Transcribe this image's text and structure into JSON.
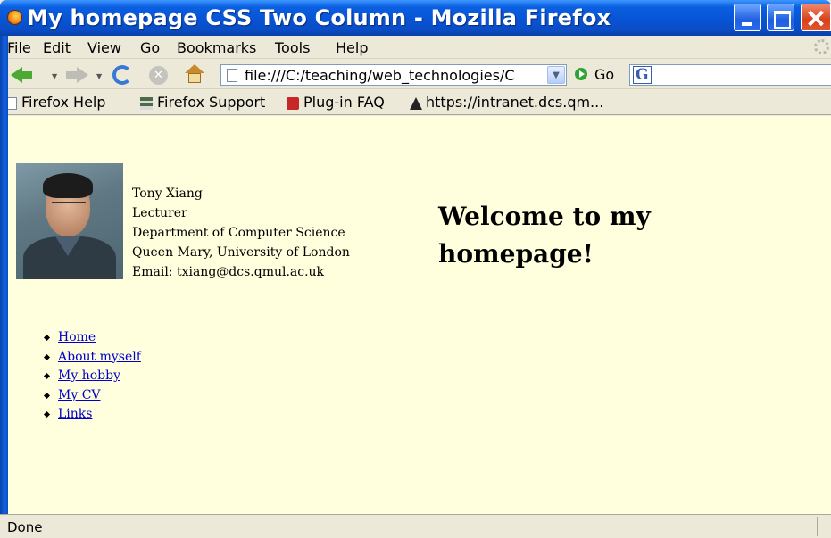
{
  "window": {
    "title": "My homepage CSS Two Column - Mozilla Firefox"
  },
  "menu": {
    "items": [
      "File",
      "Edit",
      "View",
      "Go",
      "Bookmarks",
      "Tools",
      "Help"
    ]
  },
  "navbar": {
    "url": "file:///C:/teaching/web_technologies/C",
    "go_label": "Go"
  },
  "bookmarks": {
    "items": [
      "Firefox Help",
      "Firefox Support",
      "Plug-in FAQ",
      "https://intranet.dcs.qm..."
    ]
  },
  "profile": {
    "name": "Tony Xiang",
    "role": "Lecturer",
    "department": "Department of Computer Science",
    "university": "Queen Mary, University of London",
    "email": "Email: txiang@dcs.qmul.ac.uk"
  },
  "welcome": {
    "heading": "Welcome to my homepage!"
  },
  "nav_links": [
    "Home",
    "About myself",
    "My hobby",
    "My CV",
    "Links"
  ],
  "status": {
    "text": "Done"
  },
  "colors": {
    "titlebar": "#0854d6",
    "page_background": "#ffffdd",
    "link": "#0000cc"
  },
  "icons": [
    "firefox-icon",
    "minimize-icon",
    "maximize-icon",
    "close-icon",
    "back-icon",
    "forward-icon",
    "reload-icon",
    "stop-icon",
    "home-icon",
    "page-icon",
    "go-icon",
    "google-icon"
  ]
}
